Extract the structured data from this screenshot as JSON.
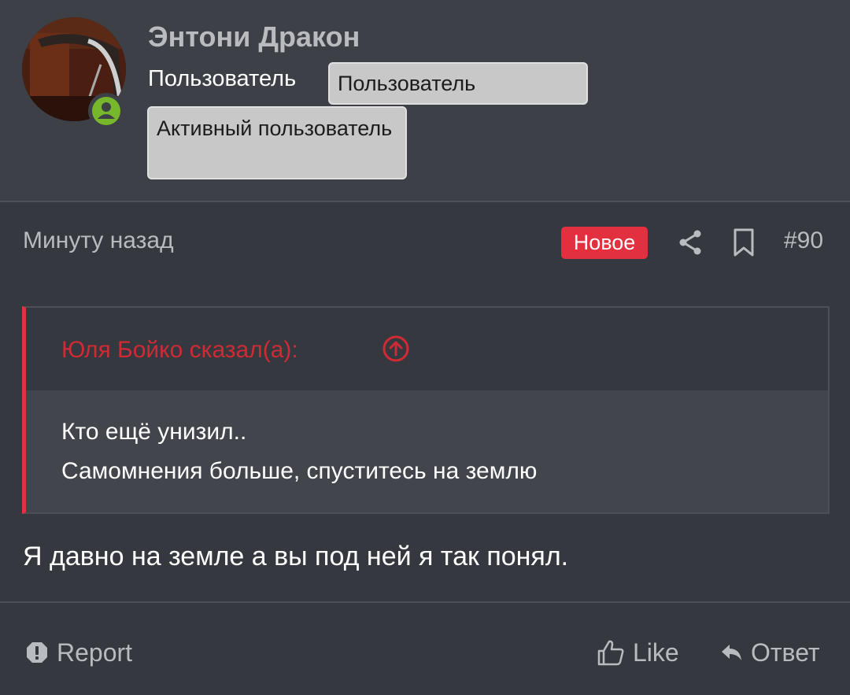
{
  "post": {
    "author": {
      "name": "Энтони Дракон",
      "title": "Пользователь",
      "badges": [
        "Пользователь",
        "Активный пользователь"
      ]
    },
    "meta": {
      "time": "Минуту назад",
      "new_label": "Новое",
      "number": "#90"
    },
    "quote": {
      "author": "Юля Бойко сказал(а):",
      "lines": [
        "Кто ещё унизил..",
        "Самомнения больше, спуститесь на землю"
      ]
    },
    "message": "Я давно на земле а вы под ней я так понял.",
    "actions": {
      "report": "Report",
      "like": "Like",
      "reply": "Ответ"
    }
  },
  "colors": {
    "background": "#35383f",
    "header_bg": "#3d4047",
    "accent_red": "#e3303f",
    "quote_author": "#d02a35",
    "online": "#77b72b",
    "badge_bg": "#c8c8c8"
  }
}
